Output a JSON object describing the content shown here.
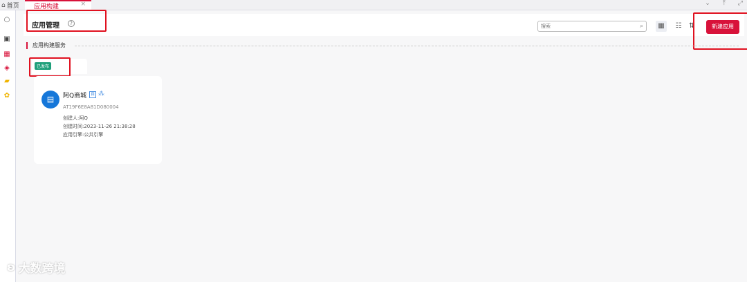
{
  "tabbar": {
    "home_label": "首页",
    "active_tab_label": "应用构建",
    "close_glyph": "×"
  },
  "header": {
    "title": "应用管理",
    "help_glyph": "?",
    "search_placeholder": "搜索",
    "new_button_label": "新建应用"
  },
  "section": {
    "title": "应用构建服务"
  },
  "app_card": {
    "status_badge": "已发布",
    "name": "阿Q商城",
    "type_badge": "自",
    "id": "AT19F6E8A81D080004",
    "creator": "创建人:阿Q",
    "created_time": "创建时间:2023-11-26 21:38:28",
    "engine": "应用引擎:公共引擎"
  },
  "watermark": {
    "text": "大数跨境"
  },
  "colors": {
    "accent": "#d8123a",
    "badge_green": "#1e9f7a",
    "avatar_blue": "#1677d9",
    "highlight_box": "#e0101f"
  }
}
